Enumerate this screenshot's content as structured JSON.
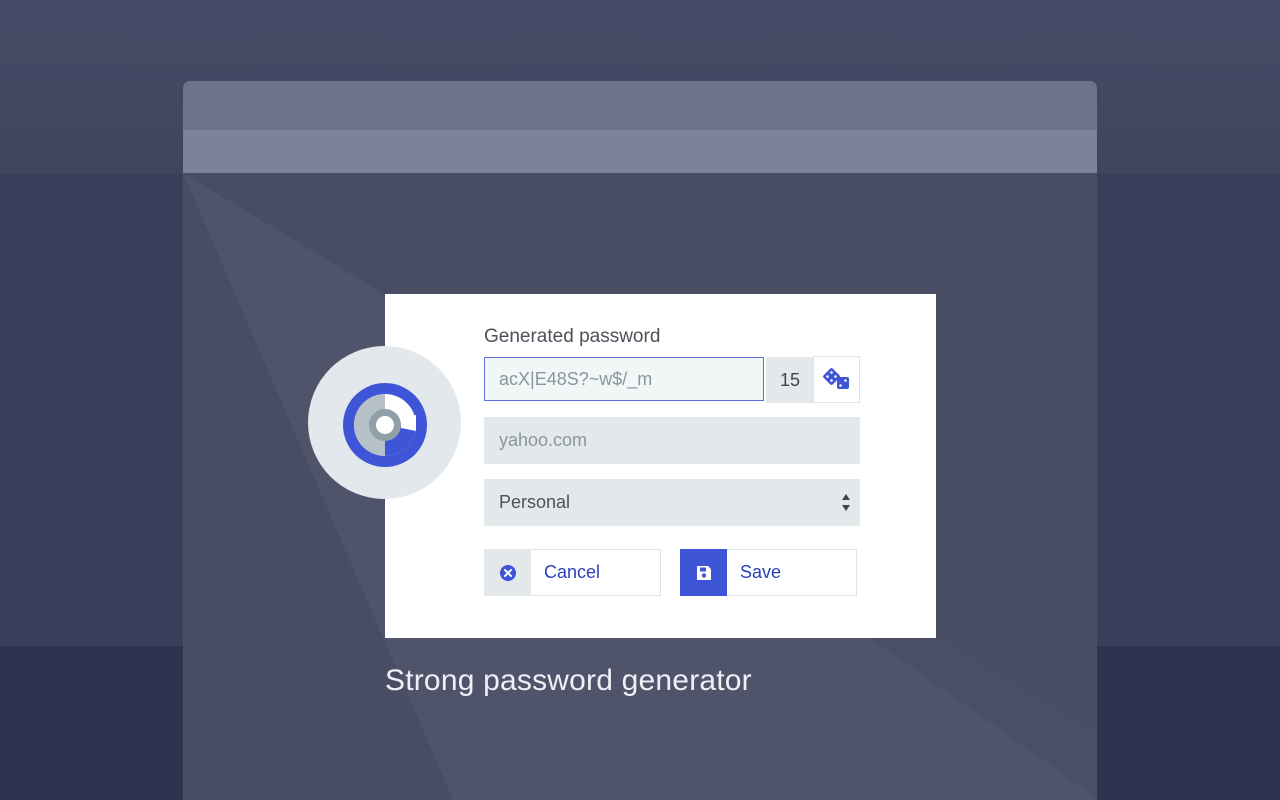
{
  "form": {
    "password_label": "Generated password",
    "password_value": "acX|E48S?~w$/_m",
    "length_value": "15",
    "dice_icon": "dice-icon",
    "site_value": "yahoo.com",
    "folder_value": "Personal",
    "cancel_label": "Cancel",
    "cancel_icon": "close-circle-icon",
    "save_label": "Save",
    "save_icon": "floppy-disk-icon"
  },
  "caption": "Strong password generator",
  "colors": {
    "accent": "#3d55d6",
    "link_text": "#2a3fb8",
    "field_bg": "#e3e9eb",
    "background": "#3e4260"
  }
}
